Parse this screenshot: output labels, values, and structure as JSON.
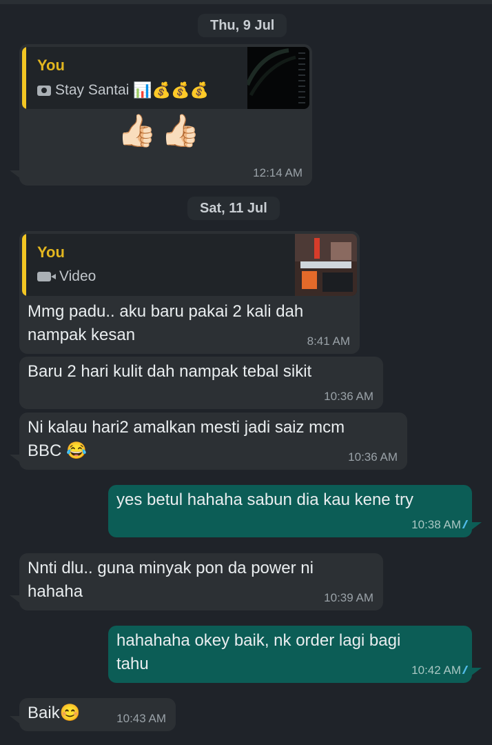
{
  "dates": [
    "Thu, 9 Jul",
    "Sat, 11 Jul"
  ],
  "messages": [
    {
      "direction": "incoming",
      "quote": {
        "author": "You",
        "type_icon": "camera-icon",
        "text": "Stay Santai"
      },
      "quote_emojis": "📊💰💰💰",
      "body": "👍🏻👍🏻",
      "time": "12:14 AM"
    },
    {
      "direction": "incoming",
      "quote": {
        "author": "You",
        "type_icon": "video-icon",
        "text": "Video"
      },
      "lines": [
        "Mmg padu.. aku baru pakai 2 kali dah",
        "nampak kesan"
      ],
      "time": "8:41 AM"
    },
    {
      "direction": "incoming",
      "lines": [
        "Baru 2 hari kulit dah nampak tebal sikit"
      ],
      "time": "10:36 AM"
    },
    {
      "direction": "incoming",
      "lines": [
        "Ni kalau hari2 amalkan mesti jadi saiz mcm",
        "BBC 😂"
      ],
      "time": "10:36 AM"
    },
    {
      "direction": "outgoing",
      "lines": [
        "yes betul hahaha sabun dia kau kene try"
      ],
      "time": "10:38 AM",
      "read_icon": "double-check-icon"
    },
    {
      "direction": "incoming",
      "lines": [
        "Nnti dlu.. guna minyak pon da power ni",
        "hahaha"
      ],
      "time": "10:39 AM"
    },
    {
      "direction": "outgoing",
      "lines": [
        "hahahaha okey baik,  nk order lagi bagi",
        "tahu"
      ],
      "time": "10:42 AM",
      "read_icon": "double-check-icon"
    },
    {
      "direction": "incoming",
      "lines": [
        "Baik😊"
      ],
      "time": "10:43 AM"
    }
  ],
  "colors": {
    "background": "#1f2329",
    "incoming_bubble": "#2c3034",
    "outgoing_bubble": "#0c5d56",
    "quote_accent": "#f3c623",
    "read_ticks": "#53bdeb"
  }
}
